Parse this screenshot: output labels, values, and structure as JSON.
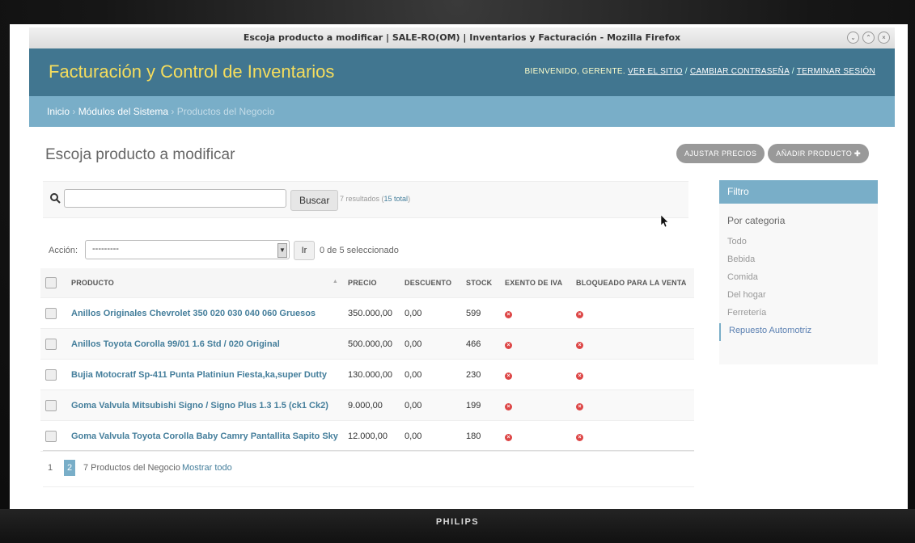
{
  "window": {
    "title": "Escoja producto a modificar | SALE-RO(OM) | Inventarios y Facturación - Mozilla Firefox"
  },
  "header": {
    "site_title": "Facturación y Control de Inventarios",
    "welcome": "Bienvenido, Gerente.",
    "view_site": "Ver el sitio",
    "change_password": "Cambiar contraseña",
    "logout": "Terminar sesión"
  },
  "breadcrumbs": {
    "home": "Inicio",
    "modules": "Módulos del Sistema",
    "current": "Productos del Negocio"
  },
  "page": {
    "title": "Escoja producto a modificar"
  },
  "object_tools": {
    "adjust_prices": "Ajustar precios",
    "add_product": "Añadir producto"
  },
  "search": {
    "placeholder": "",
    "button": "Buscar",
    "results": "7 resultados (",
    "total": "15 total",
    "close": ")"
  },
  "actions": {
    "label": "Acción:",
    "selected": "---------",
    "go": "Ir",
    "count": "0 de 5 seleccionado"
  },
  "table": {
    "headers": [
      "Producto",
      "Precio",
      "Descuento",
      "Stock",
      "Exento de IVA",
      "Bloqueado para la venta"
    ],
    "rows": [
      {
        "producto": "Anillos Originales Chevrolet 350 020 030 040 060 Gruesos",
        "precio": "350.000,00",
        "descuento": "0,00",
        "stock": "599"
      },
      {
        "producto": "Anillos Toyota Corolla 99/01 1.6 Std / 020 Original",
        "precio": "500.000,00",
        "descuento": "0,00",
        "stock": "466"
      },
      {
        "producto": "Bujia Motocratf Sp-411 Punta Platiniun Fiesta,ka,super Dutty",
        "precio": "130.000,00",
        "descuento": "0,00",
        "stock": "230"
      },
      {
        "producto": "Goma Valvula Mitsubishi Signo / Signo Plus 1.3 1.5 (ck1 Ck2)",
        "precio": "9.000,00",
        "descuento": "0,00",
        "stock": "199"
      },
      {
        "producto": "Goma Valvula Toyota Corolla Baby Camry Pantallita Sapito Sky",
        "precio": "12.000,00",
        "descuento": "0,00",
        "stock": "180"
      }
    ]
  },
  "paginator": {
    "page1": "1",
    "page2": "2",
    "count": "7 Productos del Negocio",
    "show_all": "Mostrar todo"
  },
  "filter": {
    "title": "Filtro",
    "by": "Por categoria",
    "items": [
      "Todo",
      "Bebida",
      "Comida",
      "Del hogar",
      "Ferretería",
      "Repuesto Automotriz"
    ]
  },
  "monitor": {
    "brand": "PHILIPS"
  },
  "colors": {
    "header": "#417690",
    "breadcrumbs": "#79aec8",
    "site_title": "#f5dd5d",
    "link": "#447e9b",
    "no_icon": "#dd4646"
  }
}
